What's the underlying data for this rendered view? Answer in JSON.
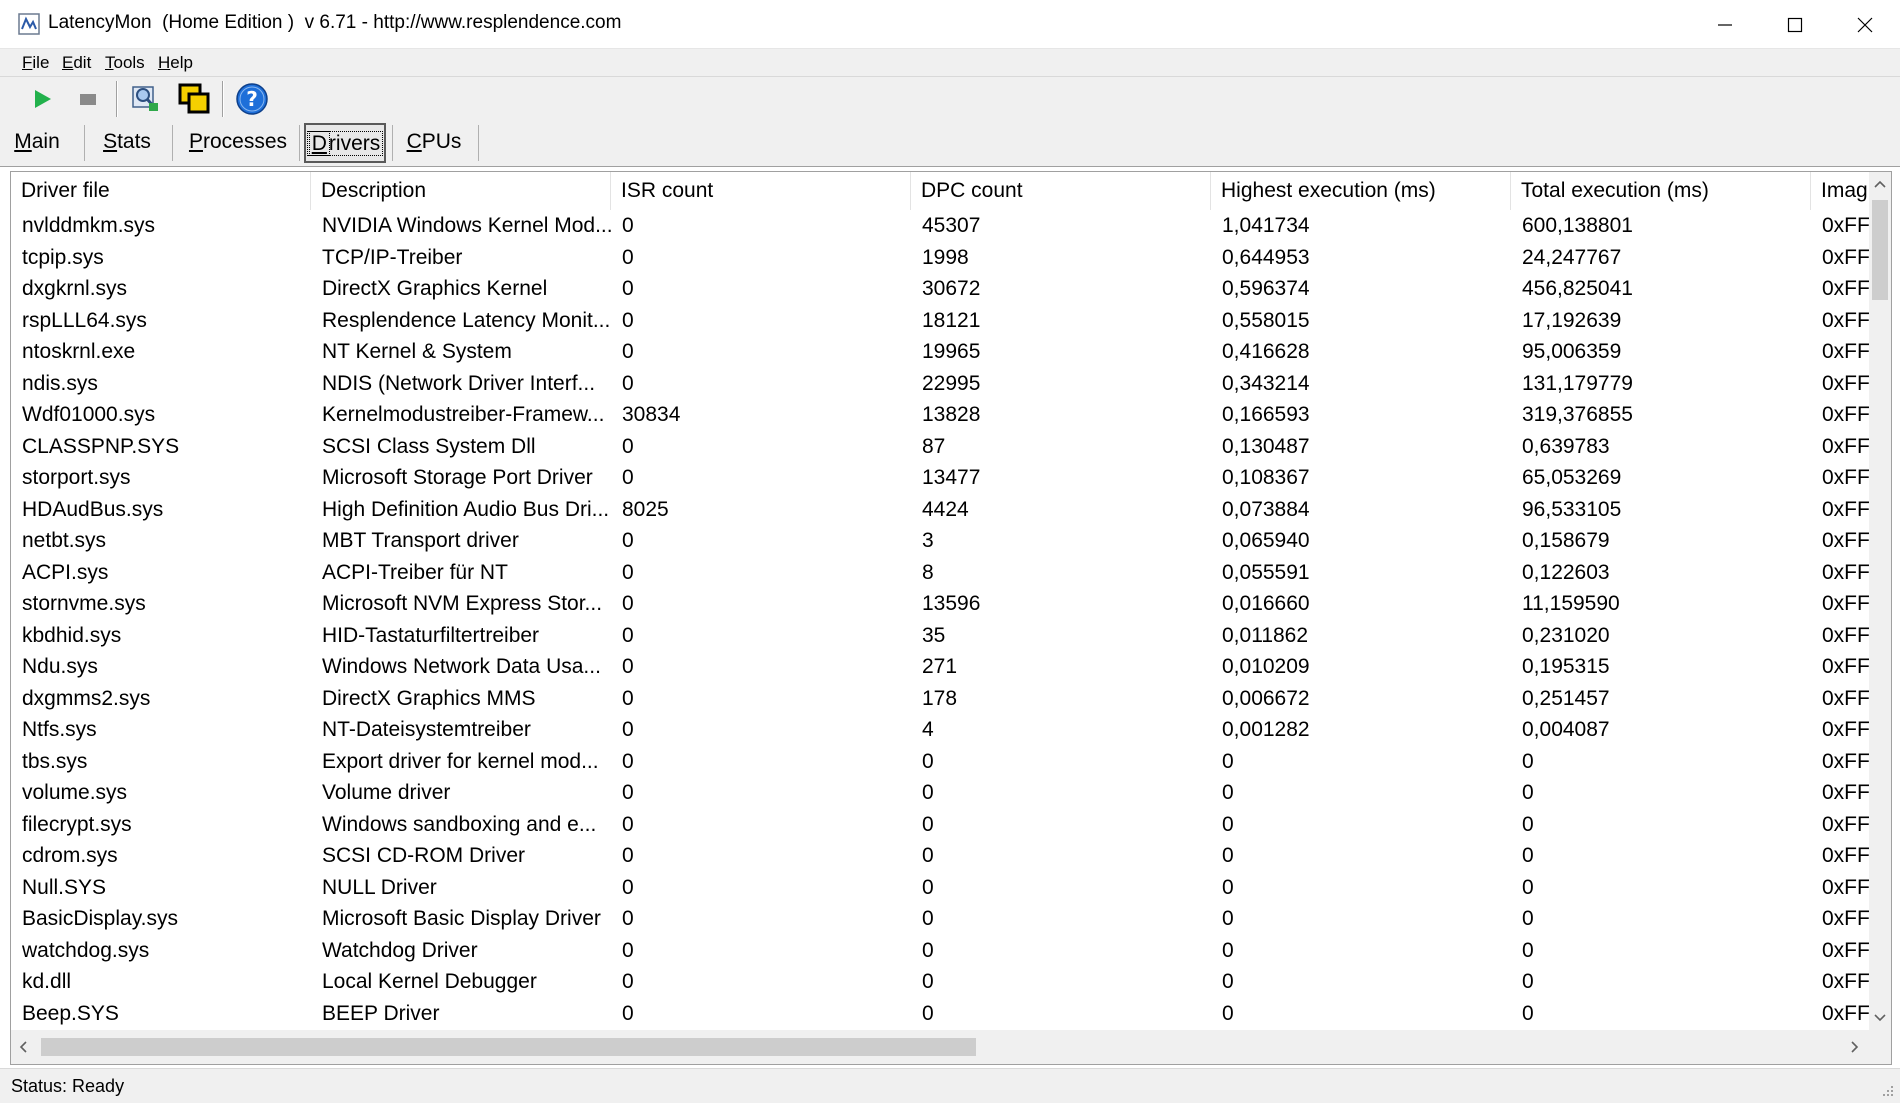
{
  "window": {
    "title": "LatencyMon  (Home Edition )  v 6.71 - http://www.resplendence.com",
    "icon": "latencymon-icon"
  },
  "menu": [
    {
      "label": "File"
    },
    {
      "label": "Edit"
    },
    {
      "label": "Tools"
    },
    {
      "label": "Help"
    }
  ],
  "toolbar": {
    "start": "play-icon",
    "stop": "stop-icon",
    "tool1": "process-view-icon",
    "tool2": "copy-windows-icon",
    "help": "help-icon"
  },
  "tabs": [
    {
      "label": "Main",
      "active": false
    },
    {
      "label": "Stats",
      "active": false
    },
    {
      "label": "Processes",
      "active": false
    },
    {
      "label": "Drivers",
      "active": true
    },
    {
      "label": "CPUs",
      "active": false
    }
  ],
  "table": {
    "columns": [
      "Driver file",
      "Description",
      "ISR count",
      "DPC count",
      "Highest execution (ms)",
      "Total execution (ms)",
      "Imag"
    ],
    "rows": [
      [
        "nvlddmkm.sys",
        "NVIDIA Windows Kernel Mod...",
        "0",
        "45307",
        "1,041734",
        "600,138801",
        "0xFF"
      ],
      [
        "tcpip.sys",
        "TCP/IP-Treiber",
        "0",
        "1998",
        "0,644953",
        "24,247767",
        "0xFF"
      ],
      [
        "dxgkrnl.sys",
        "DirectX Graphics Kernel",
        "0",
        "30672",
        "0,596374",
        "456,825041",
        "0xFF"
      ],
      [
        "rspLLL64.sys",
        "Resplendence Latency Monit...",
        "0",
        "18121",
        "0,558015",
        "17,192639",
        "0xFF"
      ],
      [
        "ntoskrnl.exe",
        "NT Kernel & System",
        "0",
        "19965",
        "0,416628",
        "95,006359",
        "0xFF"
      ],
      [
        "ndis.sys",
        "NDIS (Network Driver Interf...",
        "0",
        "22995",
        "0,343214",
        "131,179779",
        "0xFF"
      ],
      [
        "Wdf01000.sys",
        "Kernelmodustreiber-Framew...",
        "30834",
        "13828",
        "0,166593",
        "319,376855",
        "0xFF"
      ],
      [
        "CLASSPNP.SYS",
        "SCSI Class System Dll",
        "0",
        "87",
        "0,130487",
        "0,639783",
        "0xFF"
      ],
      [
        "storport.sys",
        "Microsoft Storage Port Driver",
        "0",
        "13477",
        "0,108367",
        "65,053269",
        "0xFF"
      ],
      [
        "HDAudBus.sys",
        "High Definition Audio Bus Dri...",
        "8025",
        "4424",
        "0,073884",
        "96,533105",
        "0xFF"
      ],
      [
        "netbt.sys",
        "MBT Transport driver",
        "0",
        "3",
        "0,065940",
        "0,158679",
        "0xFF"
      ],
      [
        "ACPI.sys",
        "ACPI-Treiber für NT",
        "0",
        "8",
        "0,055591",
        "0,122603",
        "0xFF"
      ],
      [
        "stornvme.sys",
        "Microsoft NVM Express Stor...",
        "0",
        "13596",
        "0,016660",
        "11,159590",
        "0xFF"
      ],
      [
        "kbdhid.sys",
        "HID-Tastaturfiltertreiber",
        "0",
        "35",
        "0,011862",
        "0,231020",
        "0xFF"
      ],
      [
        "Ndu.sys",
        "Windows Network Data Usa...",
        "0",
        "271",
        "0,010209",
        "0,195315",
        "0xFF"
      ],
      [
        "dxgmms2.sys",
        "DirectX Graphics MMS",
        "0",
        "178",
        "0,006672",
        "0,251457",
        "0xFF"
      ],
      [
        "Ntfs.sys",
        "NT-Dateisystemtreiber",
        "0",
        "4",
        "0,001282",
        "0,004087",
        "0xFF"
      ],
      [
        "tbs.sys",
        "Export driver for kernel mod...",
        "0",
        "0",
        "0",
        "0",
        "0xFF"
      ],
      [
        "volume.sys",
        "Volume driver",
        "0",
        "0",
        "0",
        "0",
        "0xFF"
      ],
      [
        "filecrypt.sys",
        "Windows sandboxing and e...",
        "0",
        "0",
        "0",
        "0",
        "0xFF"
      ],
      [
        "cdrom.sys",
        "SCSI CD-ROM Driver",
        "0",
        "0",
        "0",
        "0",
        "0xFF"
      ],
      [
        "Null.SYS",
        "NULL Driver",
        "0",
        "0",
        "0",
        "0",
        "0xFF"
      ],
      [
        "BasicDisplay.sys",
        "Microsoft Basic Display Driver",
        "0",
        "0",
        "0",
        "0",
        "0xFF"
      ],
      [
        "watchdog.sys",
        "Watchdog Driver",
        "0",
        "0",
        "0",
        "0",
        "0xFF"
      ],
      [
        "kd.dll",
        "Local Kernel Debugger",
        "0",
        "0",
        "0",
        "0",
        "0xFF"
      ],
      [
        "Beep.SYS",
        "BEEP Driver",
        "0",
        "0",
        "0",
        "0",
        "0xFF"
      ]
    ]
  },
  "status": {
    "text": "Status: Ready"
  },
  "colors": {
    "play": "#22b14c",
    "help": "#1e6fd9",
    "chrome": "#f0f0f0"
  }
}
